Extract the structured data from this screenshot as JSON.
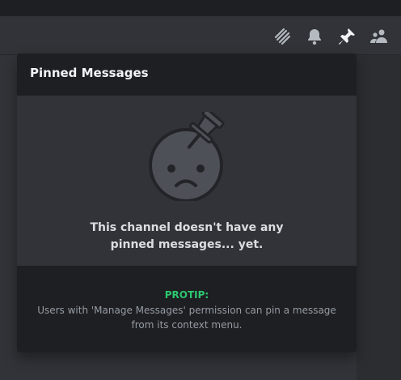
{
  "header": {
    "icons": [
      "threads-icon",
      "notification-bell-icon",
      "pin-icon",
      "member-list-icon"
    ]
  },
  "pins_popout": {
    "title": "Pinned Messages",
    "empty_state": {
      "icon": "sad-face-pin-icon",
      "line1": "This channel doesn't have any",
      "line2": "pinned messages... yet."
    },
    "protip": {
      "label": "PROTIP:",
      "line1": "Users with 'Manage Messages' permission can pin a message",
      "line2": "from its context menu."
    }
  },
  "colors": {
    "accent_green": "#2dc770",
    "popout_bg": "#2b2d31",
    "header_bg": "#1e1f22"
  }
}
